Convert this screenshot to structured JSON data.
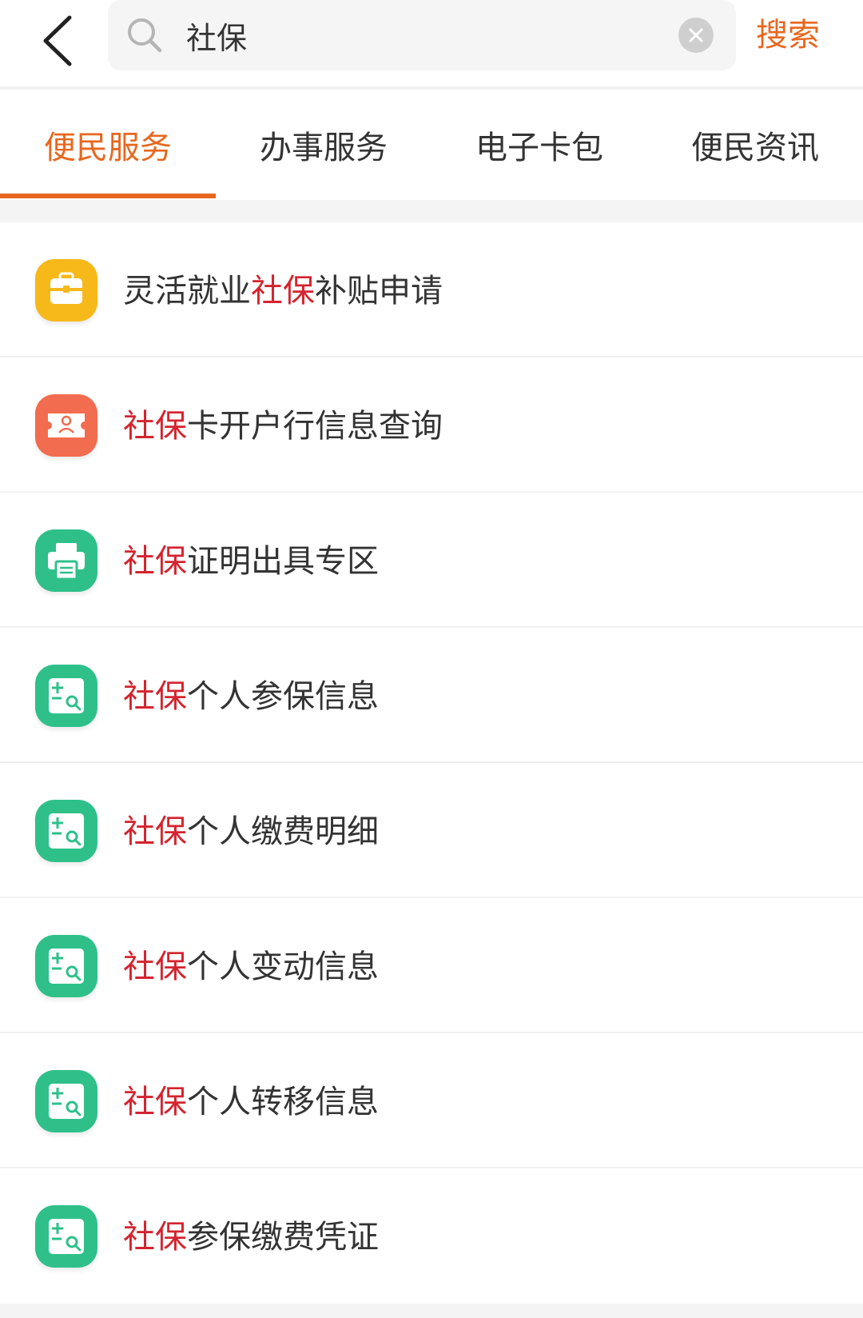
{
  "header": {
    "search_query": "社保",
    "search_button": "搜索"
  },
  "tabs": [
    {
      "label": "便民服务",
      "active": true
    },
    {
      "label": "办事服务",
      "active": false
    },
    {
      "label": "电子卡包",
      "active": false
    },
    {
      "label": "便民资讯",
      "active": false
    }
  ],
  "colors": {
    "accent": "#e8671e",
    "highlight": "#d4242f",
    "icon_yellow": "#f7b81a",
    "icon_orange": "#f26c4f",
    "icon_green": "#2fc08a"
  },
  "list": [
    {
      "icon": "briefcase-icon",
      "pre": "灵活就业",
      "hl": "社保",
      "post": "补贴申请"
    },
    {
      "icon": "id-card-icon",
      "pre": "",
      "hl": "社保",
      "post": "卡开户行信息查询"
    },
    {
      "icon": "printer-icon",
      "pre": "",
      "hl": "社保",
      "post": "证明出具专区"
    },
    {
      "icon": "search-document-icon",
      "pre": "",
      "hl": "社保",
      "post": "个人参保信息"
    },
    {
      "icon": "search-document-icon",
      "pre": "",
      "hl": "社保",
      "post": "个人缴费明细"
    },
    {
      "icon": "search-document-icon",
      "pre": "",
      "hl": "社保",
      "post": "个人变动信息"
    },
    {
      "icon": "search-document-icon",
      "pre": "",
      "hl": "社保",
      "post": "个人转移信息"
    },
    {
      "icon": "search-document-icon",
      "pre": "",
      "hl": "社保",
      "post": "参保缴费凭证"
    }
  ]
}
